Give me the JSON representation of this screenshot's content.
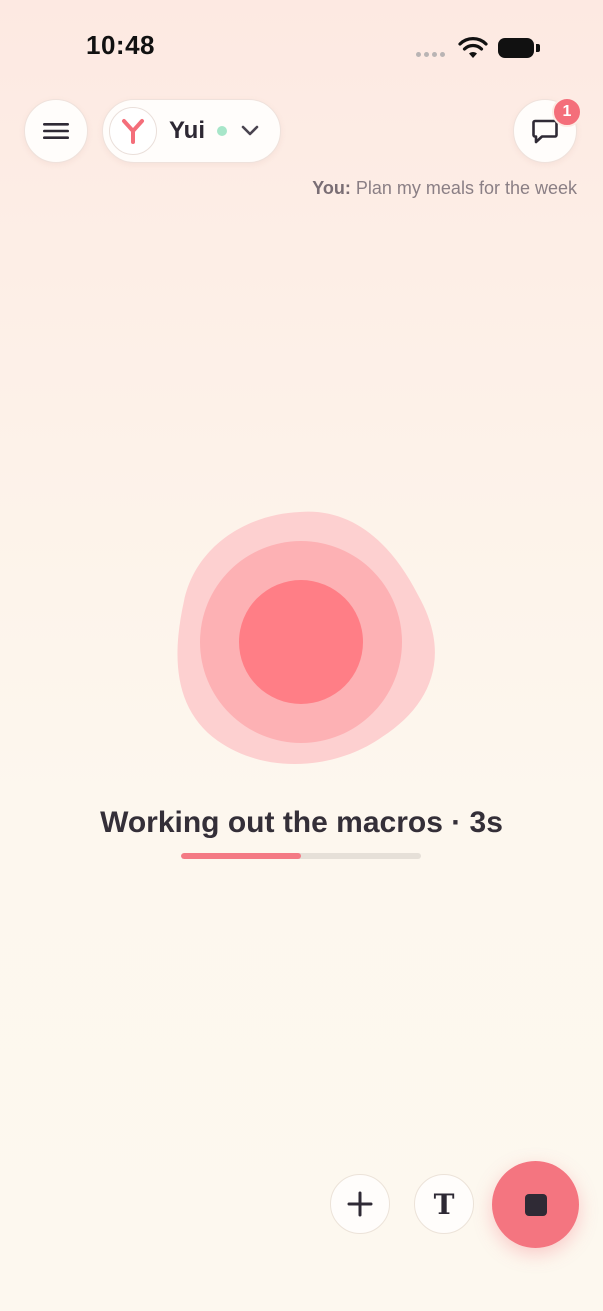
{
  "status_bar": {
    "time": "10:48"
  },
  "header": {
    "menu_icon": "hamburger-menu-icon",
    "agent": {
      "name": "Yui",
      "avatar_icon": "y-logo-icon",
      "status": "online",
      "status_color": "#a7e6c9"
    },
    "chat_icon": "chat-bubble-icon",
    "chat_badge_count": "1",
    "last_message": {
      "sender": "You:",
      "text": "Plan my meals for the week"
    }
  },
  "main": {
    "status_text": "Working out the macros · 3s",
    "progress_percent": 50
  },
  "controls": {
    "add_icon": "plus-icon",
    "text_mode_label": "T",
    "stop_icon": "stop-icon"
  },
  "colors": {
    "accent": "#f47580",
    "orb_outer": "#fdd0d0",
    "orb_middle": "#fdb1b4",
    "orb_core": "#ff7e86"
  }
}
